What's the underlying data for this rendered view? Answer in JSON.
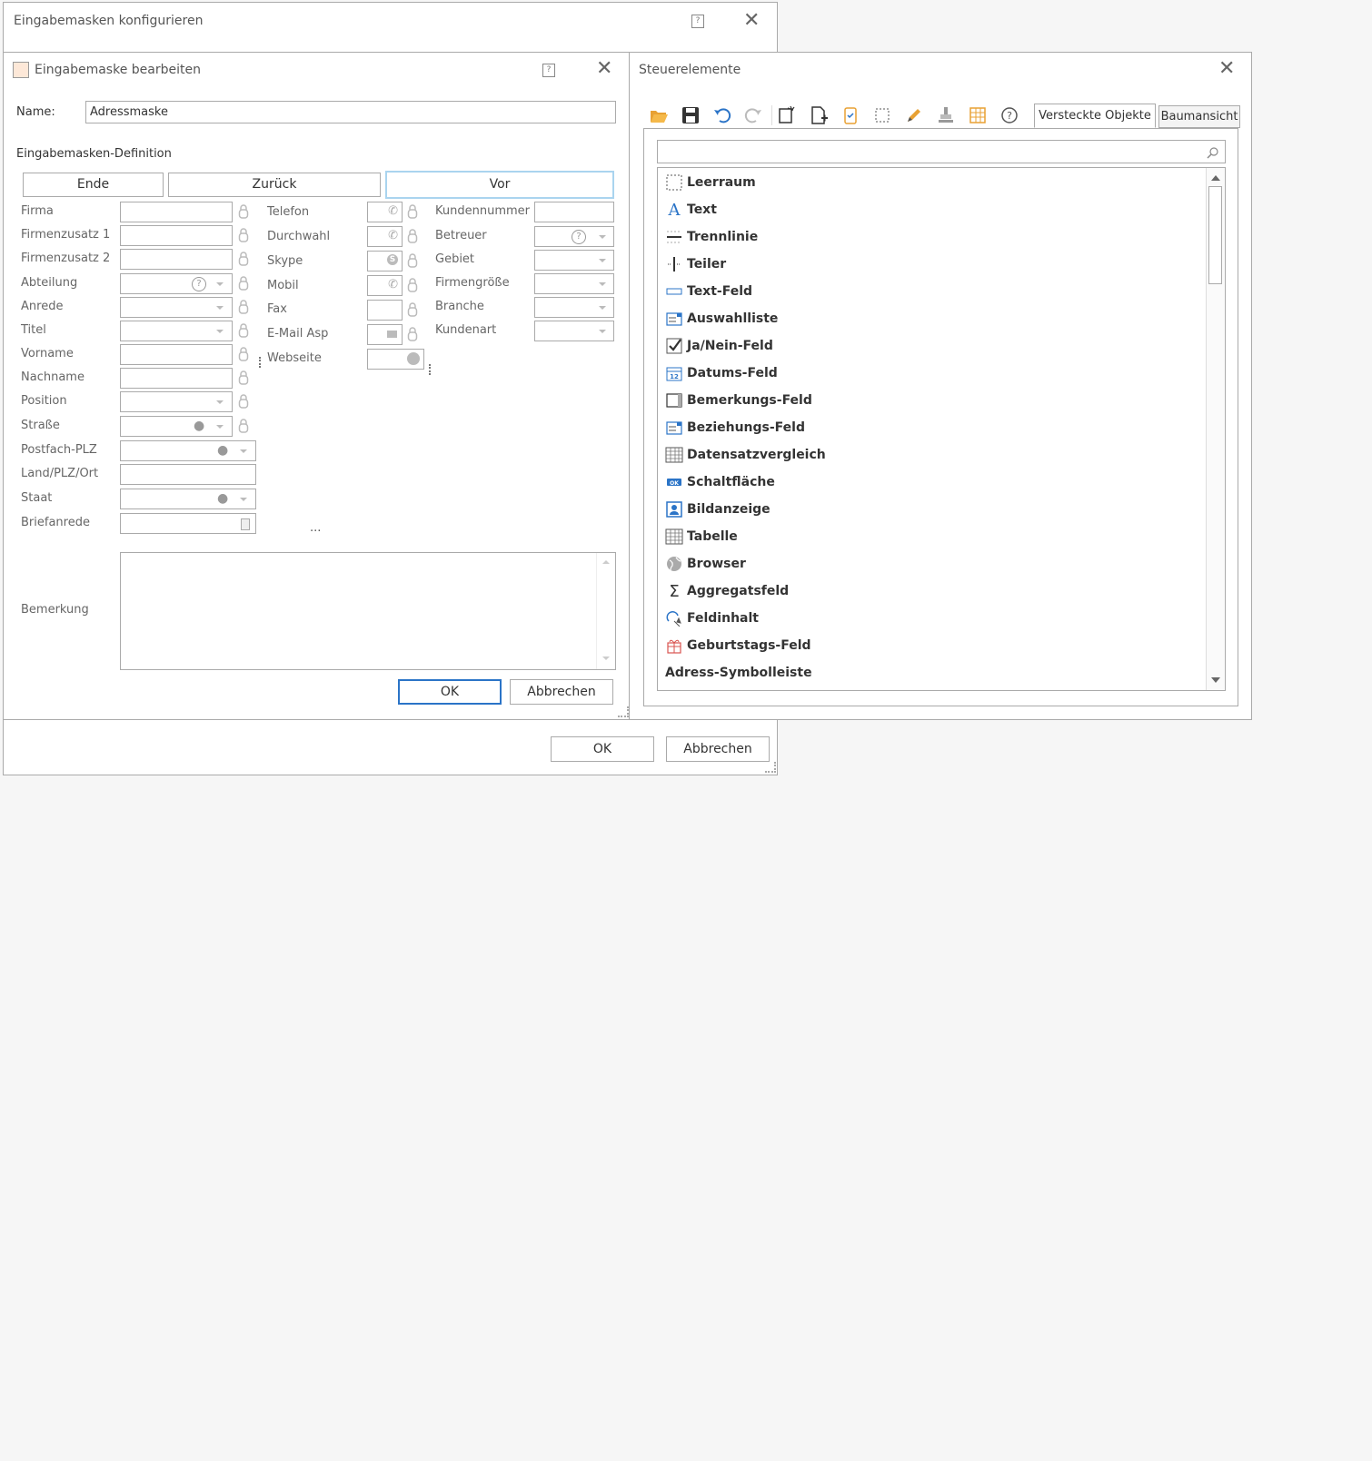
{
  "outer_dialog": {
    "title": "Eingabemasken konfigurieren",
    "ok_label": "OK",
    "cancel_label": "Abbrechen"
  },
  "edit_dialog": {
    "title": "Eingabemaske bearbeiten",
    "name_label": "Name:",
    "name_value": "Adressmaske",
    "definition_label": "Eingabemasken-Definition",
    "nav": {
      "end": "Ende",
      "back": "Zurück",
      "forward": "Vor"
    },
    "left_fields": [
      "Firma",
      "Firmenzusatz 1",
      "Firmenzusatz 2",
      "Abteilung",
      "Anrede",
      "Titel",
      "Vorname",
      "Nachname",
      "Position",
      "Straße",
      "Postfach-PLZ",
      "Land/PLZ/Ort",
      "Staat",
      "Briefanrede"
    ],
    "middle_fields": [
      "Telefon",
      "Durchwahl",
      "Skype",
      "Mobil",
      "Fax",
      "E-Mail Asp",
      "Webseite"
    ],
    "right_fields": [
      "Kundennummer",
      "Betreuer",
      "Gebiet",
      "Firmengröße",
      "Branche",
      "Kundenart"
    ],
    "ellipsis": "...",
    "remark_label": "Bemerkung",
    "ok_label": "OK",
    "cancel_label": "Abbrechen"
  },
  "controls_panel": {
    "title": "Steuerelemente",
    "tab_hidden": "Versteckte Objekte",
    "tab_tree": "Baumansicht",
    "search_placeholder": "",
    "toolbar_icons": [
      "folder-open-icon",
      "save-icon",
      "undo-icon",
      "redo-icon",
      "new-element-icon",
      "add-page-icon",
      "clipboard-icon",
      "select-frame-icon",
      "pencil-icon",
      "stamp-icon",
      "table-settings-icon",
      "help-icon"
    ],
    "items": [
      {
        "label": "Leerraum",
        "icon": "empty-space-icon"
      },
      {
        "label": "Text",
        "icon": "text-icon"
      },
      {
        "label": "Trennlinie",
        "icon": "separator-line-icon"
      },
      {
        "label": "Teiler",
        "icon": "splitter-icon"
      },
      {
        "label": "Text-Feld",
        "icon": "text-field-icon"
      },
      {
        "label": "Auswahlliste",
        "icon": "selection-list-icon"
      },
      {
        "label": "Ja/Nein-Feld",
        "icon": "checkbox-icon"
      },
      {
        "label": "Datums-Feld",
        "icon": "calendar-icon"
      },
      {
        "label": "Bemerkungs-Feld",
        "icon": "remark-field-icon"
      },
      {
        "label": "Beziehungs-Feld",
        "icon": "relation-field-icon"
      },
      {
        "label": "Datensatzvergleich",
        "icon": "grid-compare-icon"
      },
      {
        "label": "Schaltfläche",
        "icon": "button-icon"
      },
      {
        "label": "Bildanzeige",
        "icon": "image-icon"
      },
      {
        "label": "Tabelle",
        "icon": "table-icon"
      },
      {
        "label": "Browser",
        "icon": "globe-icon"
      },
      {
        "label": "Aggregatsfeld",
        "icon": "sigma-icon"
      },
      {
        "label": "Feldinhalt",
        "icon": "field-content-icon"
      },
      {
        "label": "Geburtstags-Feld",
        "icon": "gift-icon"
      },
      {
        "label": "Adress-Symbolleiste",
        "icon": ""
      }
    ]
  }
}
